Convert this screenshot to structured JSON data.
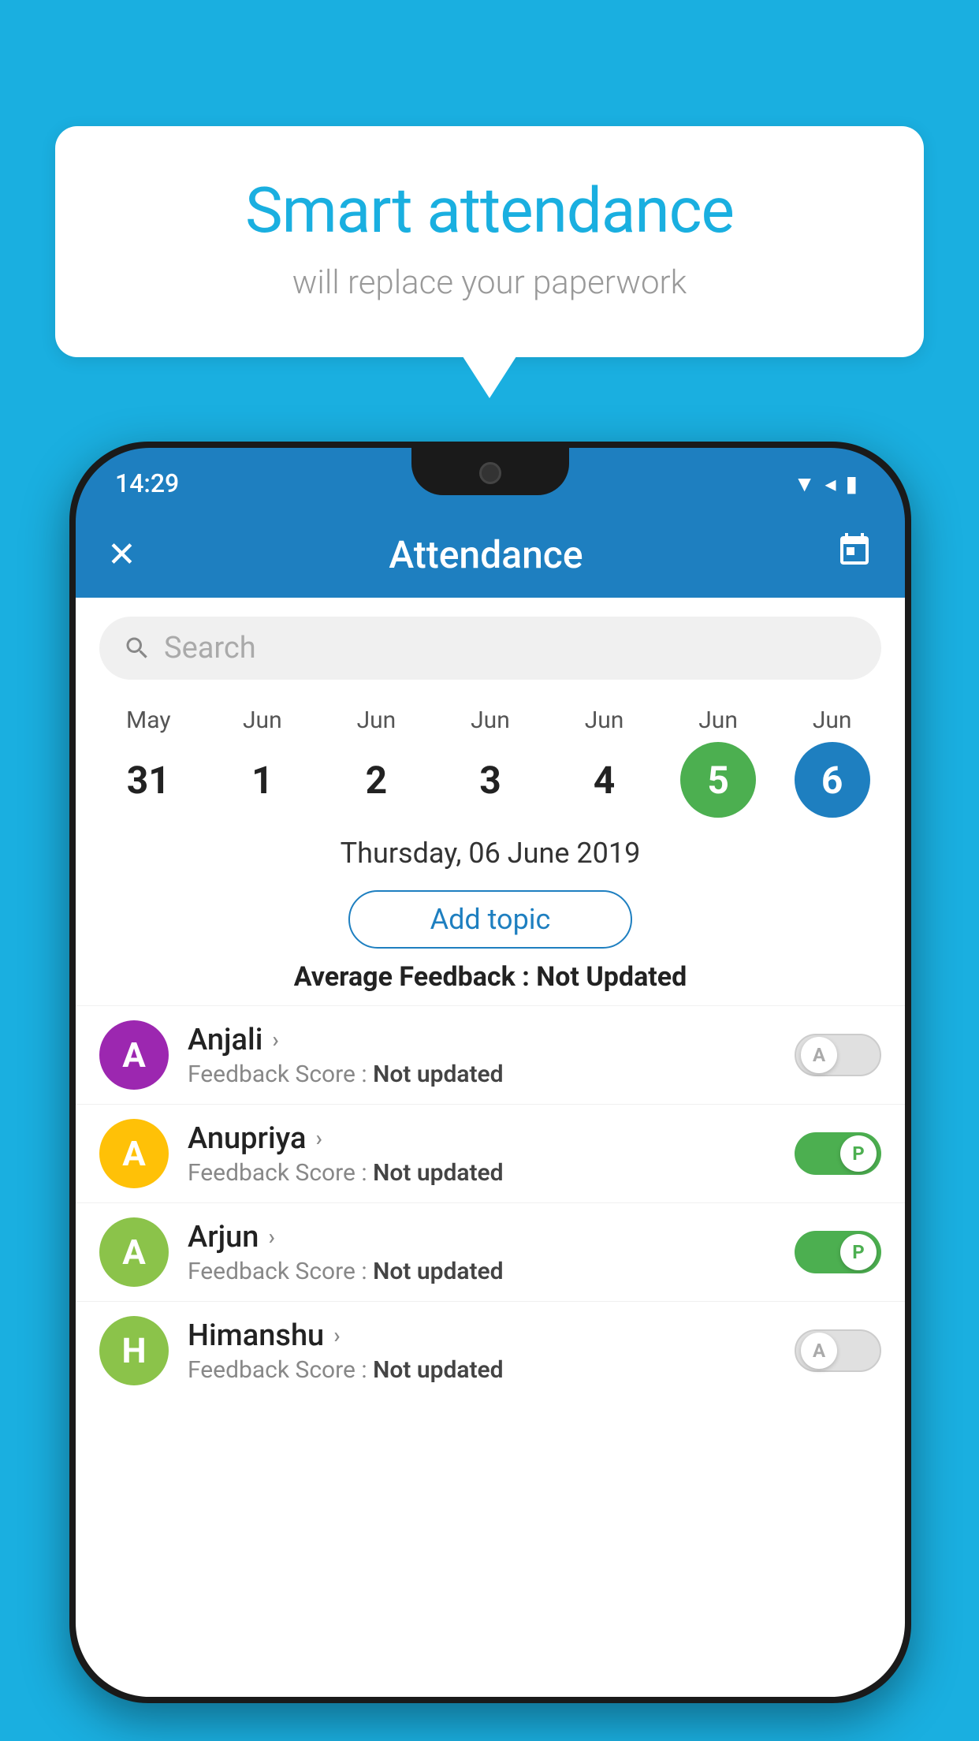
{
  "background_color": "#1AAFE0",
  "bubble": {
    "title": "Smart attendance",
    "subtitle": "will replace your paperwork"
  },
  "status_bar": {
    "time": "14:29",
    "icons": [
      "wifi",
      "signal",
      "battery"
    ]
  },
  "app_bar": {
    "title": "Attendance",
    "back_icon": "✕",
    "calendar_icon": "📅"
  },
  "search": {
    "placeholder": "Search"
  },
  "calendar": {
    "days": [
      {
        "month": "May",
        "date": "31",
        "state": "normal"
      },
      {
        "month": "Jun",
        "date": "1",
        "state": "normal"
      },
      {
        "month": "Jun",
        "date": "2",
        "state": "normal"
      },
      {
        "month": "Jun",
        "date": "3",
        "state": "normal"
      },
      {
        "month": "Jun",
        "date": "4",
        "state": "normal"
      },
      {
        "month": "Jun",
        "date": "5",
        "state": "today"
      },
      {
        "month": "Jun",
        "date": "6",
        "state": "selected"
      }
    ]
  },
  "selected_date": "Thursday, 06 June 2019",
  "add_topic_label": "Add topic",
  "avg_feedback_label": "Average Feedback :",
  "avg_feedback_value": "Not Updated",
  "students": [
    {
      "name": "Anjali",
      "initial": "A",
      "color": "#9C27B0",
      "feedback": "Not updated",
      "attendance": "absent"
    },
    {
      "name": "Anupriya",
      "initial": "A",
      "color": "#FFC107",
      "feedback": "Not updated",
      "attendance": "present"
    },
    {
      "name": "Arjun",
      "initial": "A",
      "color": "#8BC34A",
      "feedback": "Not updated",
      "attendance": "present"
    },
    {
      "name": "Himanshu",
      "initial": "H",
      "color": "#8BC34A",
      "feedback": "Not updated",
      "attendance": "absent"
    }
  ],
  "feedback_score_label": "Feedback Score :"
}
